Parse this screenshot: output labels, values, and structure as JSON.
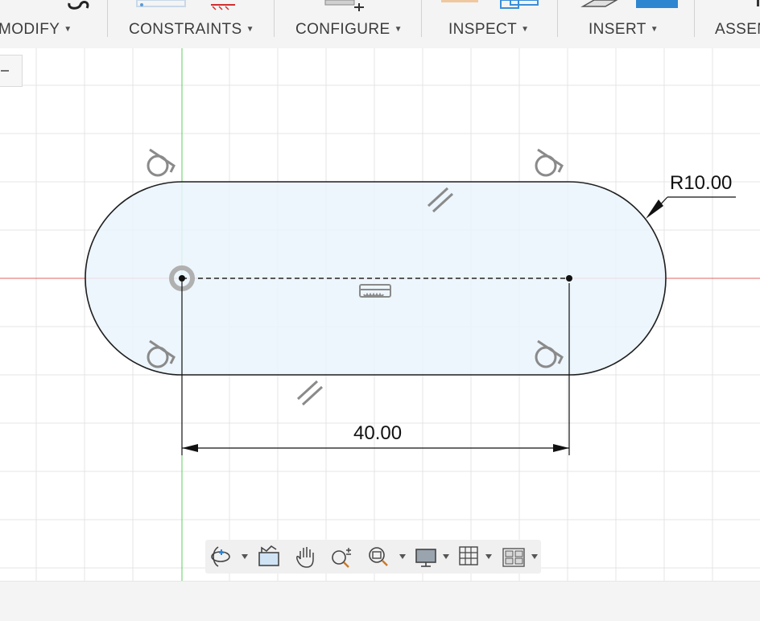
{
  "toolbar": {
    "menus": [
      {
        "id": "modify",
        "label": "MODIFY"
      },
      {
        "id": "constraints",
        "label": "CONSTRAINTS"
      },
      {
        "id": "configure",
        "label": "CONFIGURE"
      },
      {
        "id": "inspect",
        "label": "INSPECT"
      },
      {
        "id": "insert",
        "label": "INSERT"
      },
      {
        "id": "assemble",
        "label": "ASSEN"
      }
    ],
    "caret_glyph": "▼"
  },
  "sketch": {
    "radius_dimension": "R10.00",
    "length_dimension": "40.00",
    "colors": {
      "profile_fill": "#eaf4fc",
      "profile_stroke": "#1e1e1e",
      "x_axis": "#e06060",
      "y_axis": "#5ccc5c",
      "grid": "#e4e4e4",
      "constraint_glyph": "#8a8a8a"
    },
    "constraint_icons": [
      "tangent-icon",
      "tangent-icon",
      "tangent-icon",
      "tangent-icon",
      "parallel-icon",
      "parallel-icon",
      "horizontal-icon"
    ]
  },
  "navigation_bar": {
    "tools": [
      {
        "id": "orbit",
        "icon": "orbit-icon",
        "dropdown": true
      },
      {
        "id": "look-at",
        "icon": "look-at-icon",
        "dropdown": false
      },
      {
        "id": "pan",
        "icon": "pan-hand-icon",
        "dropdown": false
      },
      {
        "id": "zoom",
        "icon": "zoom-icon",
        "dropdown": false
      },
      {
        "id": "fit",
        "icon": "fit-zoom-icon",
        "dropdown": true
      },
      {
        "id": "display",
        "icon": "display-settings-icon",
        "dropdown": true
      },
      {
        "id": "grid",
        "icon": "grid-settings-icon",
        "dropdown": true
      },
      {
        "id": "viewports",
        "icon": "viewports-icon",
        "dropdown": true
      }
    ]
  }
}
